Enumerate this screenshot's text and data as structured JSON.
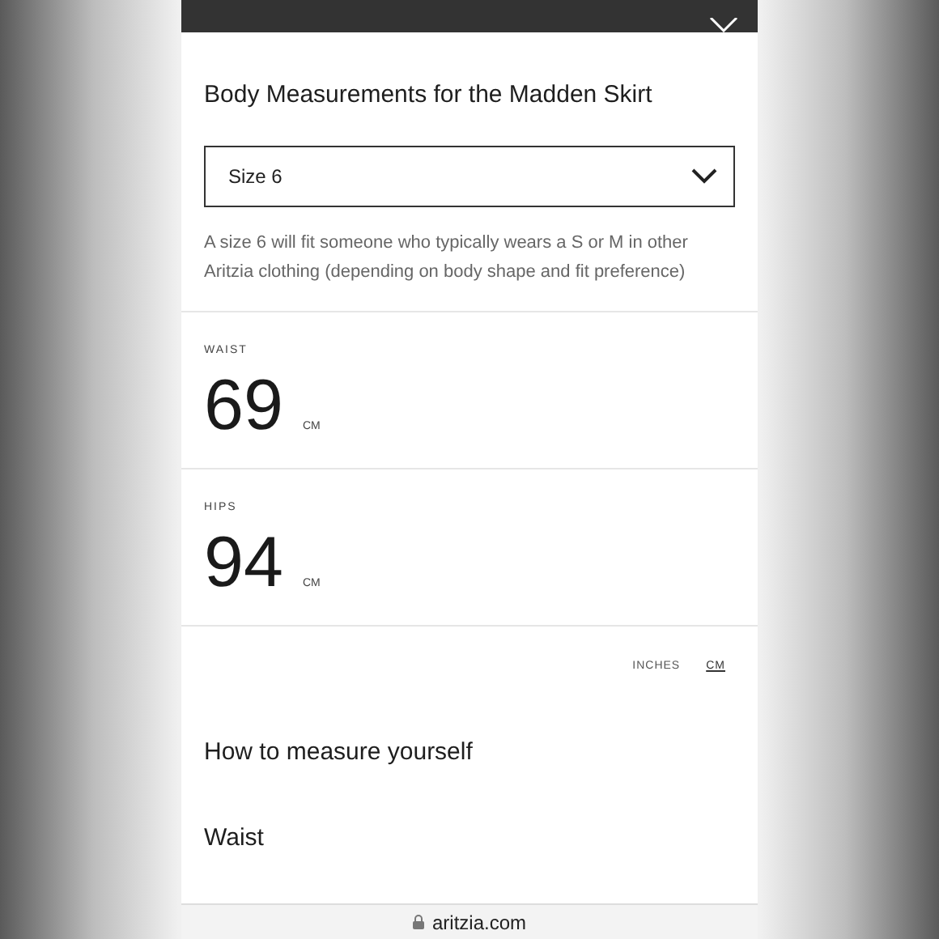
{
  "title": "Body Measurements for the Madden Skirt",
  "size_select": {
    "value": "Size 6"
  },
  "description": "A size 6 will fit someone who typically wears a S or M in other Aritzia clothing (depending on body shape and fit preference)",
  "measurements": [
    {
      "label": "WAIST",
      "value": "69",
      "unit": "CM"
    },
    {
      "label": "HIPS",
      "value": "94",
      "unit": "CM"
    }
  ],
  "unit_toggle": [
    {
      "label": "INCHES",
      "selected": false
    },
    {
      "label": "CM",
      "selected": true
    }
  ],
  "sections": [
    "How to measure yourself",
    "Waist"
  ],
  "address_bar": {
    "url": "aritzia.com"
  }
}
